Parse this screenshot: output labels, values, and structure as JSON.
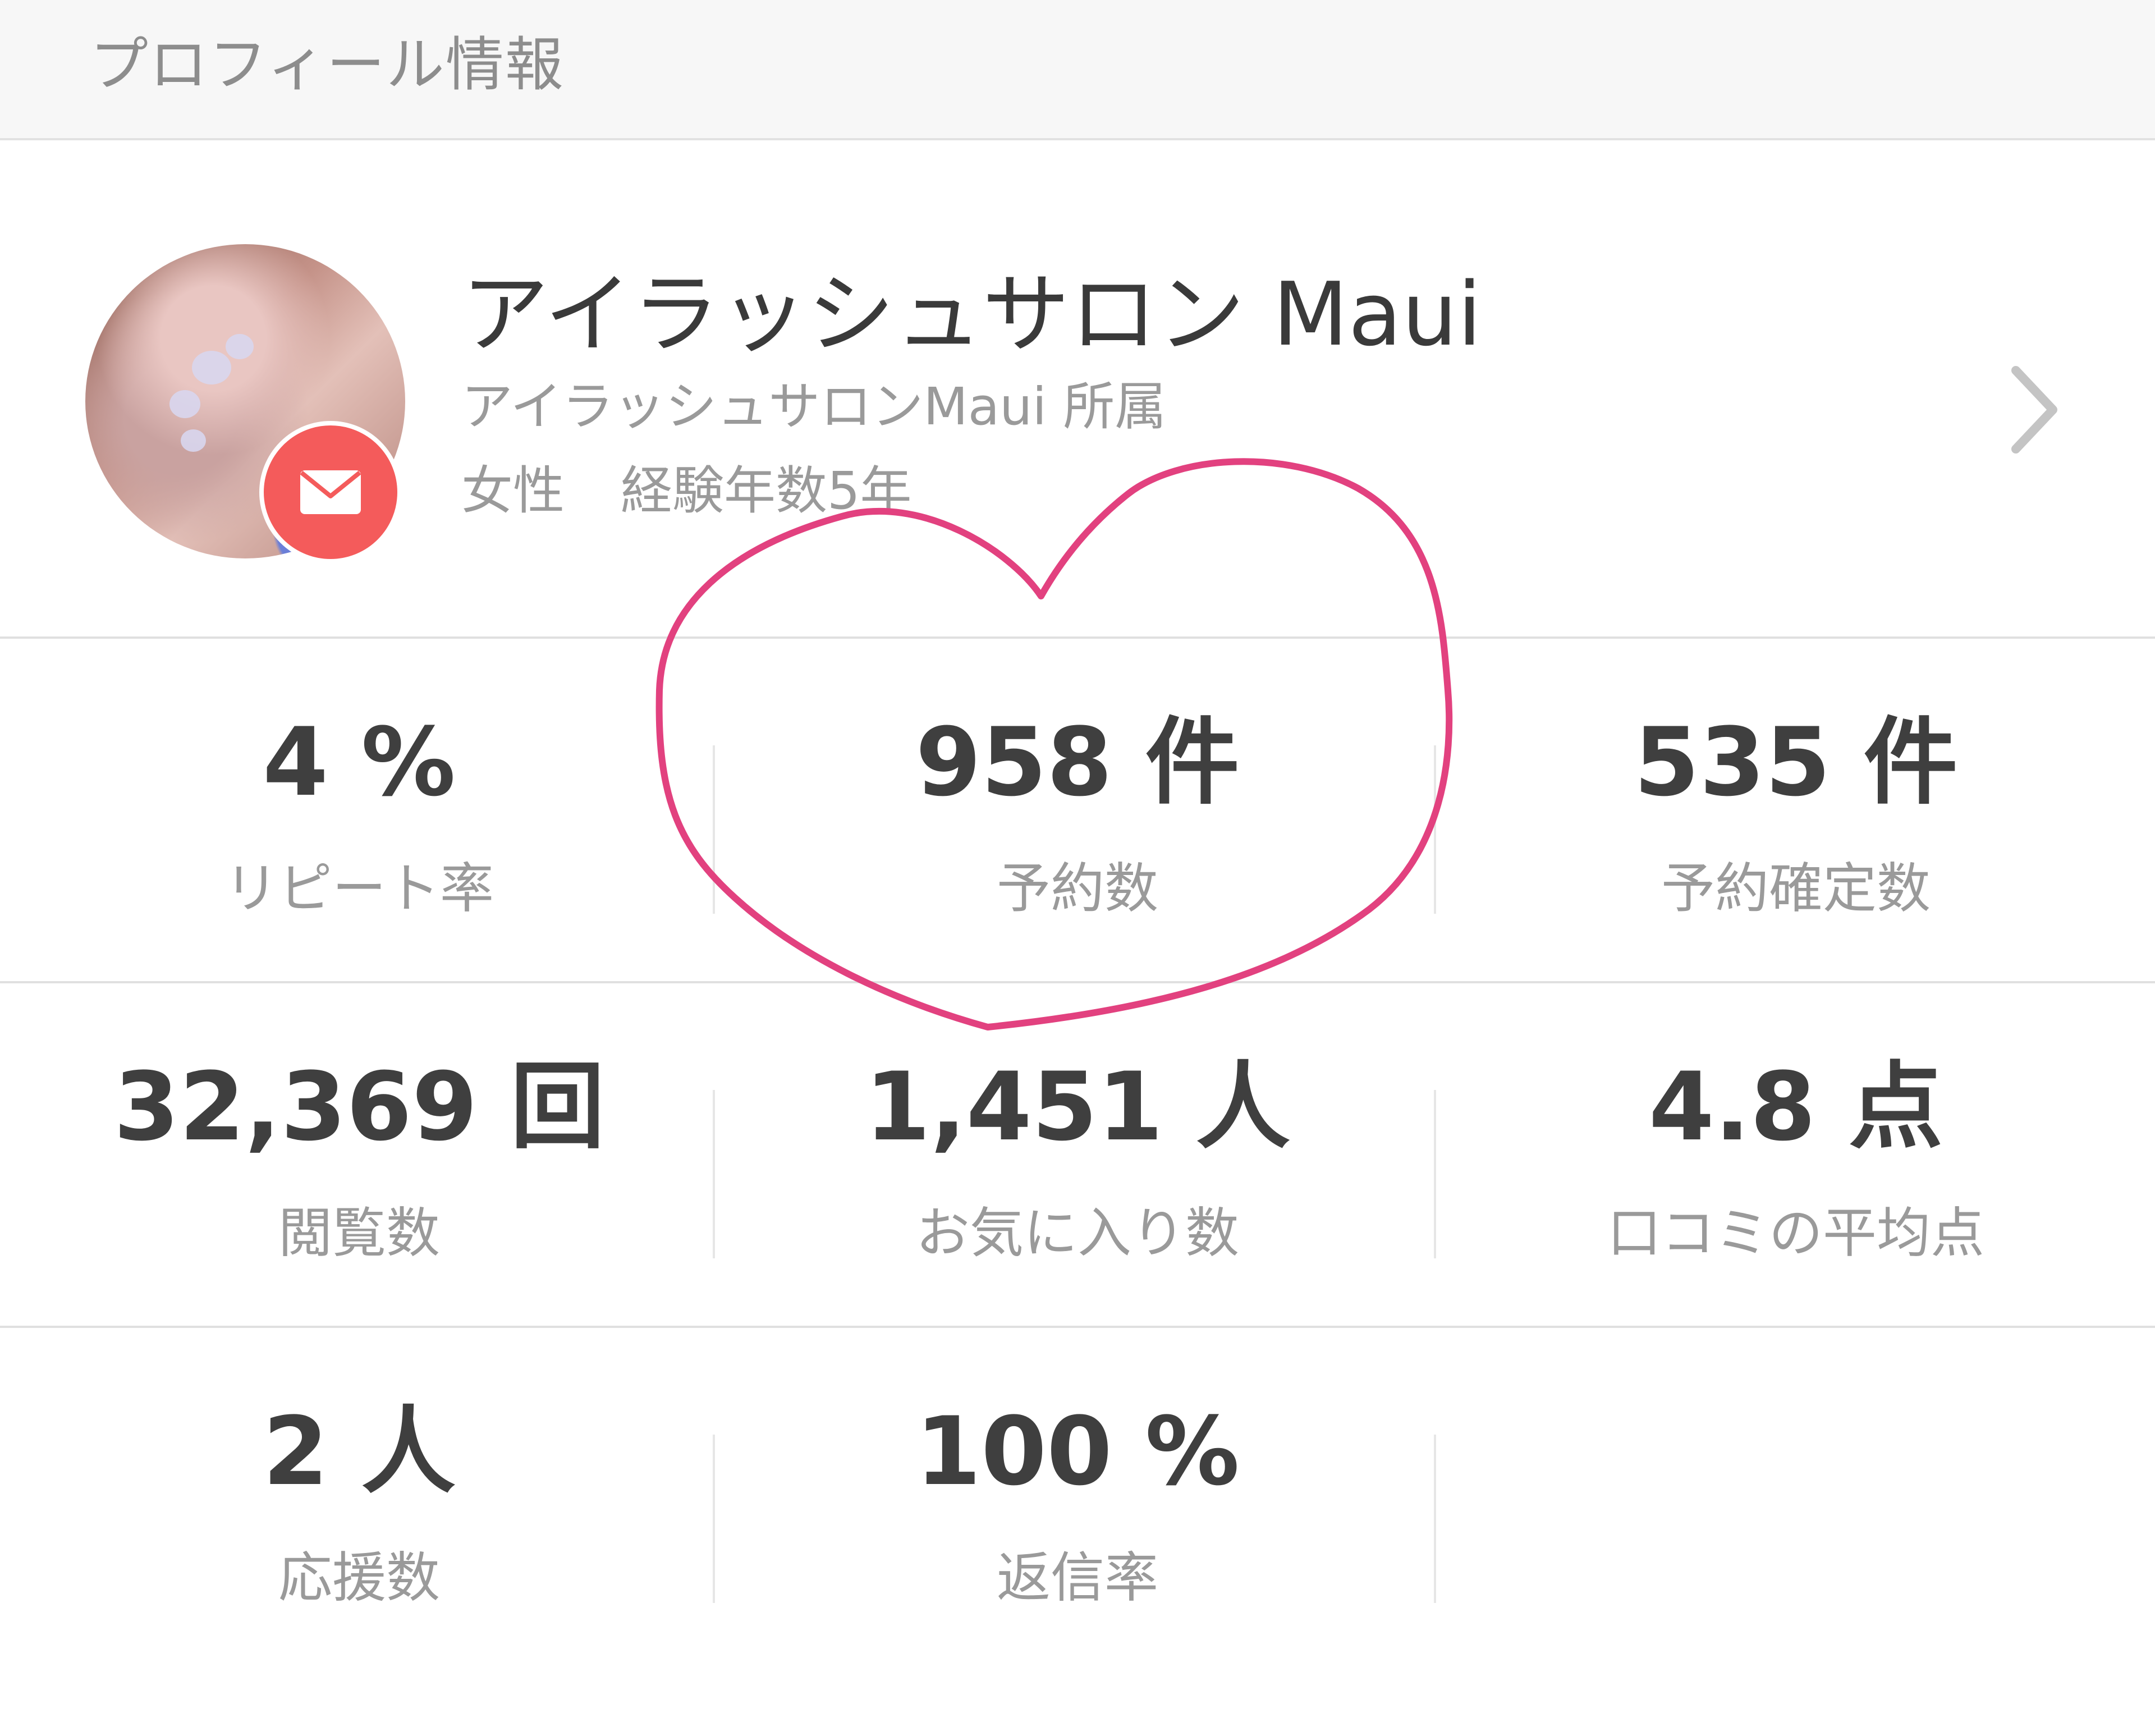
{
  "header": {
    "title": "プロフィール情報"
  },
  "profile": {
    "name": "アイラッシュサロン Maui",
    "affiliation": "アイラッシュサロンMaui 所属",
    "gender": "女性",
    "experience": "経験年数5年"
  },
  "stats": [
    [
      {
        "value": "4 %",
        "label": "リピート率"
      },
      {
        "value": "958 件",
        "label": "予約数"
      },
      {
        "value": "535 件",
        "label": "予約確定数"
      }
    ],
    [
      {
        "value": "32,369 回",
        "label": "閲覧数"
      },
      {
        "value": "1,451 人",
        "label": "お気に入り数"
      },
      {
        "value": "4.8 点",
        "label": "口コミの平均点"
      }
    ],
    [
      {
        "value": "2 人",
        "label": "応援数"
      },
      {
        "value": "100 %",
        "label": "返信率"
      },
      {
        "value": "",
        "label": ""
      }
    ]
  ],
  "colors": {
    "accent": "#f45b5b",
    "annotation": "#e2417f"
  },
  "icons": {
    "badge": "mail-icon",
    "nav": "chevron-right-icon"
  }
}
